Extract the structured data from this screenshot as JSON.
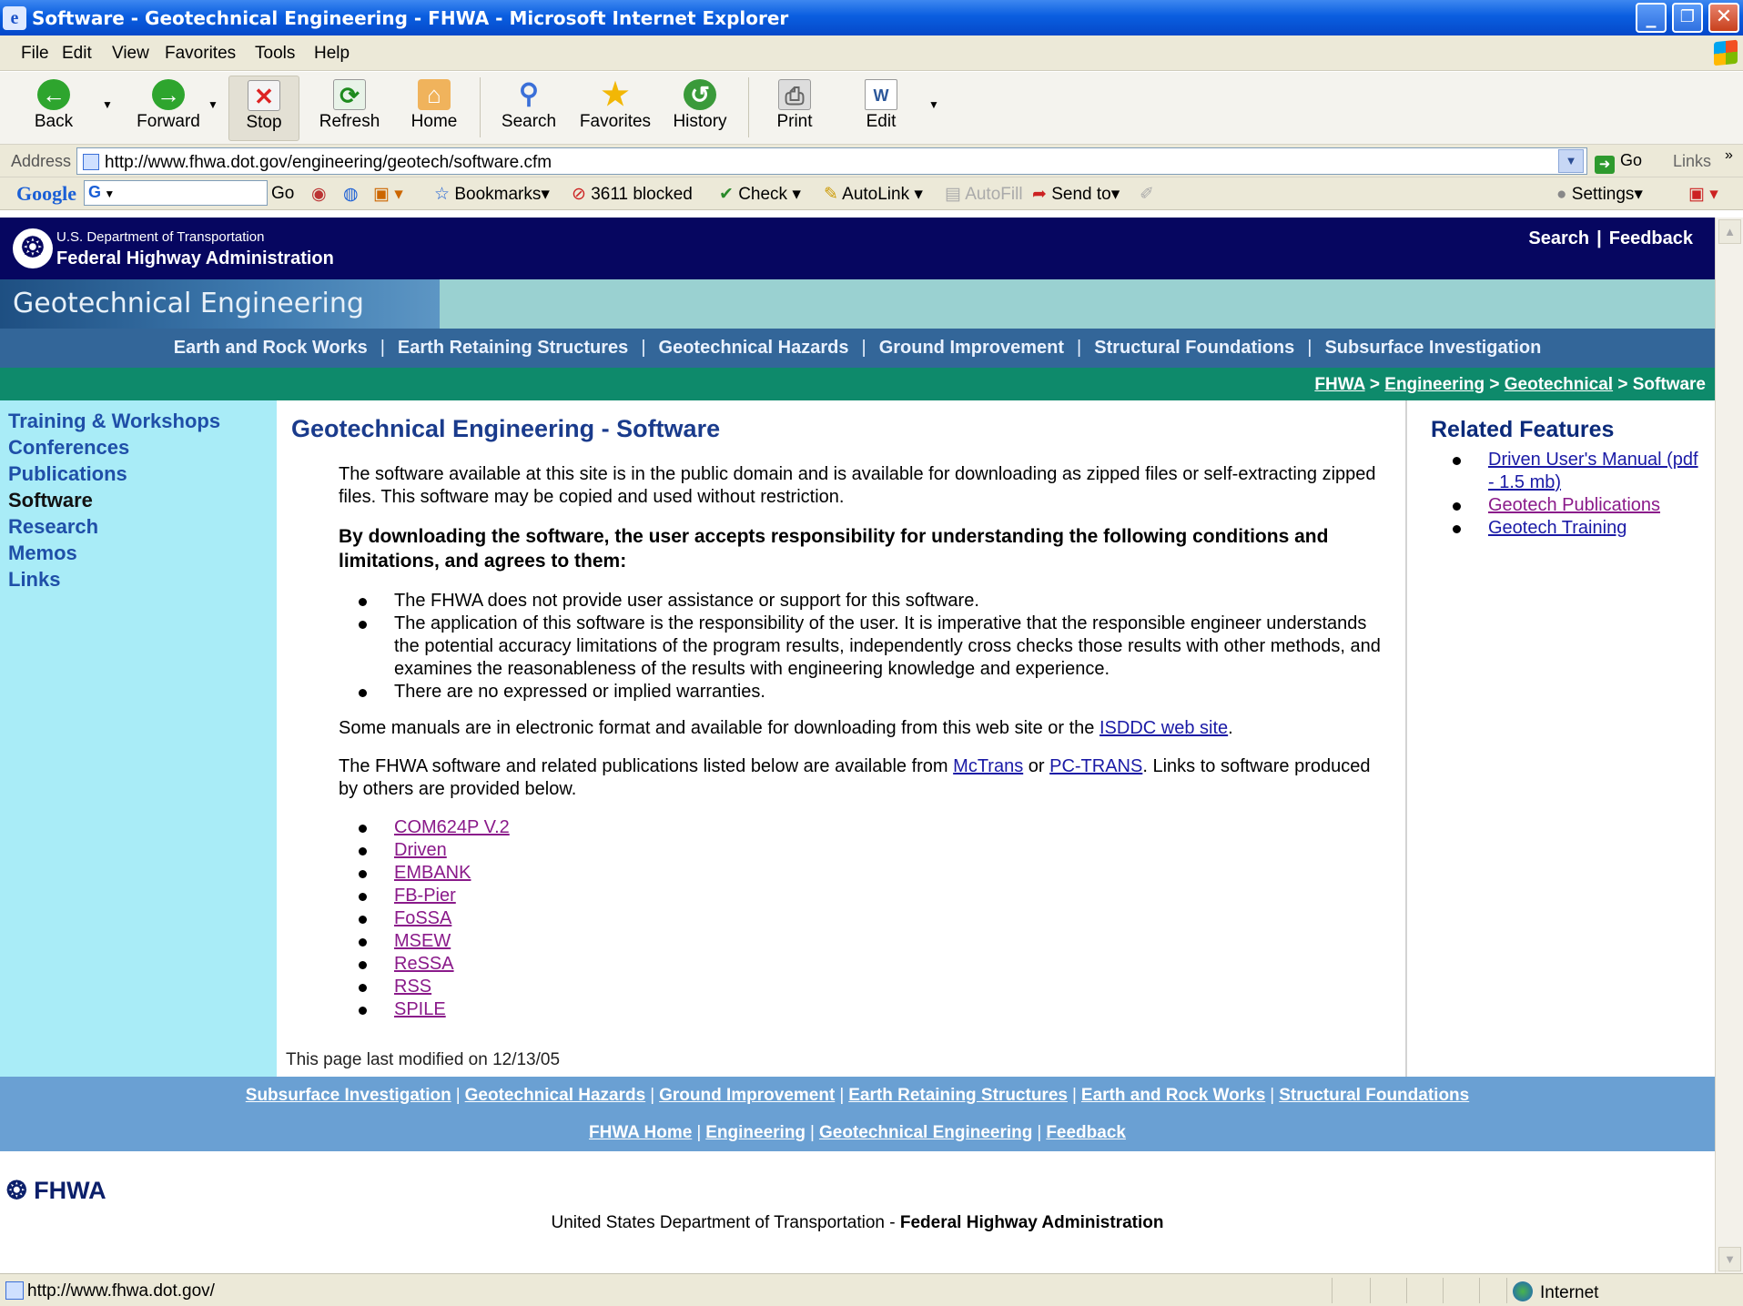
{
  "window": {
    "title": "Software - Geotechnical Engineering - FHWA - Microsoft Internet Explorer",
    "controls": {
      "minimize": "_",
      "maximize": "❐",
      "close": "✕"
    }
  },
  "menu": [
    "File",
    "Edit",
    "View",
    "Favorites",
    "Tools",
    "Help"
  ],
  "toolbar": {
    "back": "Back",
    "forward": "Forward",
    "stop": "Stop",
    "refresh": "Refresh",
    "home": "Home",
    "search": "Search",
    "favorites": "Favorites",
    "history": "History",
    "print": "Print",
    "edit": "Edit"
  },
  "address": {
    "label": "Address",
    "url": "http://www.fhwa.dot.gov/engineering/geotech/software.cfm",
    "go": "Go",
    "links": "Links"
  },
  "googlebar": {
    "logo": "Google",
    "search_prefix": "G",
    "go": "Go",
    "bookmarks": "Bookmarks",
    "blocked": "3611 blocked",
    "check": "Check",
    "autolink": "AutoLink",
    "autofill": "AutoFill",
    "sendto": "Send to",
    "settings": "Settings"
  },
  "site_header": {
    "dept": "U.S. Department of Transportation",
    "agency": "Federal Highway Administration",
    "search": "Search",
    "feedback": "Feedback",
    "section_banner": "Geotechnical Engineering"
  },
  "topnav": [
    "Earth and Rock Works",
    "Earth Retaining Structures",
    "Geotechnical Hazards",
    "Ground Improvement",
    "Structural Foundations",
    "Subsurface Investigation"
  ],
  "breadcrumb": {
    "fhwa": "FHWA",
    "engineering": "Engineering",
    "geotechnical": "Geotechnical",
    "current": "Software",
    "sep": ">"
  },
  "leftnav": [
    "Training & Workshops",
    "Conferences",
    "Publications",
    "Software",
    "Research",
    "Memos",
    "Links"
  ],
  "main": {
    "title": "Geotechnical Engineering - Software",
    "intro": "The software available at this site is in the public domain and is available for downloading as zipped files or self-extracting zipped files. This software may be copied and used without restriction.",
    "disclaimer": "By downloading the software, the user accepts responsibility for understanding the following conditions and limitations, and agrees to them:",
    "conditions": [
      "The FHWA does not provide user assistance or support for this software.",
      "The application of this software is the responsibility of the user. It is imperative that the responsible engineer understands the potential accuracy limitations of the program results, independently cross checks those results with other methods, and examines the reasonableness of the results with engineering knowledge and experience.",
      "There are no expressed or implied warranties."
    ],
    "manuals_pre": "Some manuals are in electronic format and available for downloading from this web site or the ",
    "manuals_link": "ISDDC web site",
    "manuals_post": ".",
    "avail_pre": "The FHWA software and related publications listed below are available from ",
    "avail_link1": "McTrans",
    "avail_mid": " or ",
    "avail_link2": "PC-TRANS",
    "avail_post": ". Links to software produced by others are provided below.",
    "software": [
      "COM624P V.2",
      "Driven",
      "EMBANK",
      "FB-Pier",
      "FoSSA",
      "MSEW",
      "ReSSA",
      "RSS",
      "SPILE"
    ],
    "last_modified": "This page last modified on 12/13/05"
  },
  "related": {
    "heading": "Related Features",
    "items": [
      "Driven User's Manual (pdf - 1.5 mb)",
      "Geotech Publications",
      "Geotech Training"
    ]
  },
  "footer": {
    "row1": [
      "Subsurface Investigation",
      "Geotechnical Hazards",
      "Ground Improvement",
      "Earth Retaining Structures",
      "Earth and Rock Works",
      "Structural Foundations"
    ],
    "row2": [
      "FHWA Home",
      "Engineering",
      "Geotechnical Engineering",
      "Feedback"
    ],
    "logo": "FHWA",
    "line_pre": "United States Department of Transportation - ",
    "line_bold": "Federal Highway Administration"
  },
  "status": {
    "url": "http://www.fhwa.dot.gov/",
    "zone": "Internet"
  },
  "colors": {
    "header_navy": "#060660",
    "nav_blue": "#336699",
    "crumb_green": "#0e8a6b",
    "leftnav_cyan": "#a9ecf7",
    "footer_blue": "#6aa0d3"
  }
}
